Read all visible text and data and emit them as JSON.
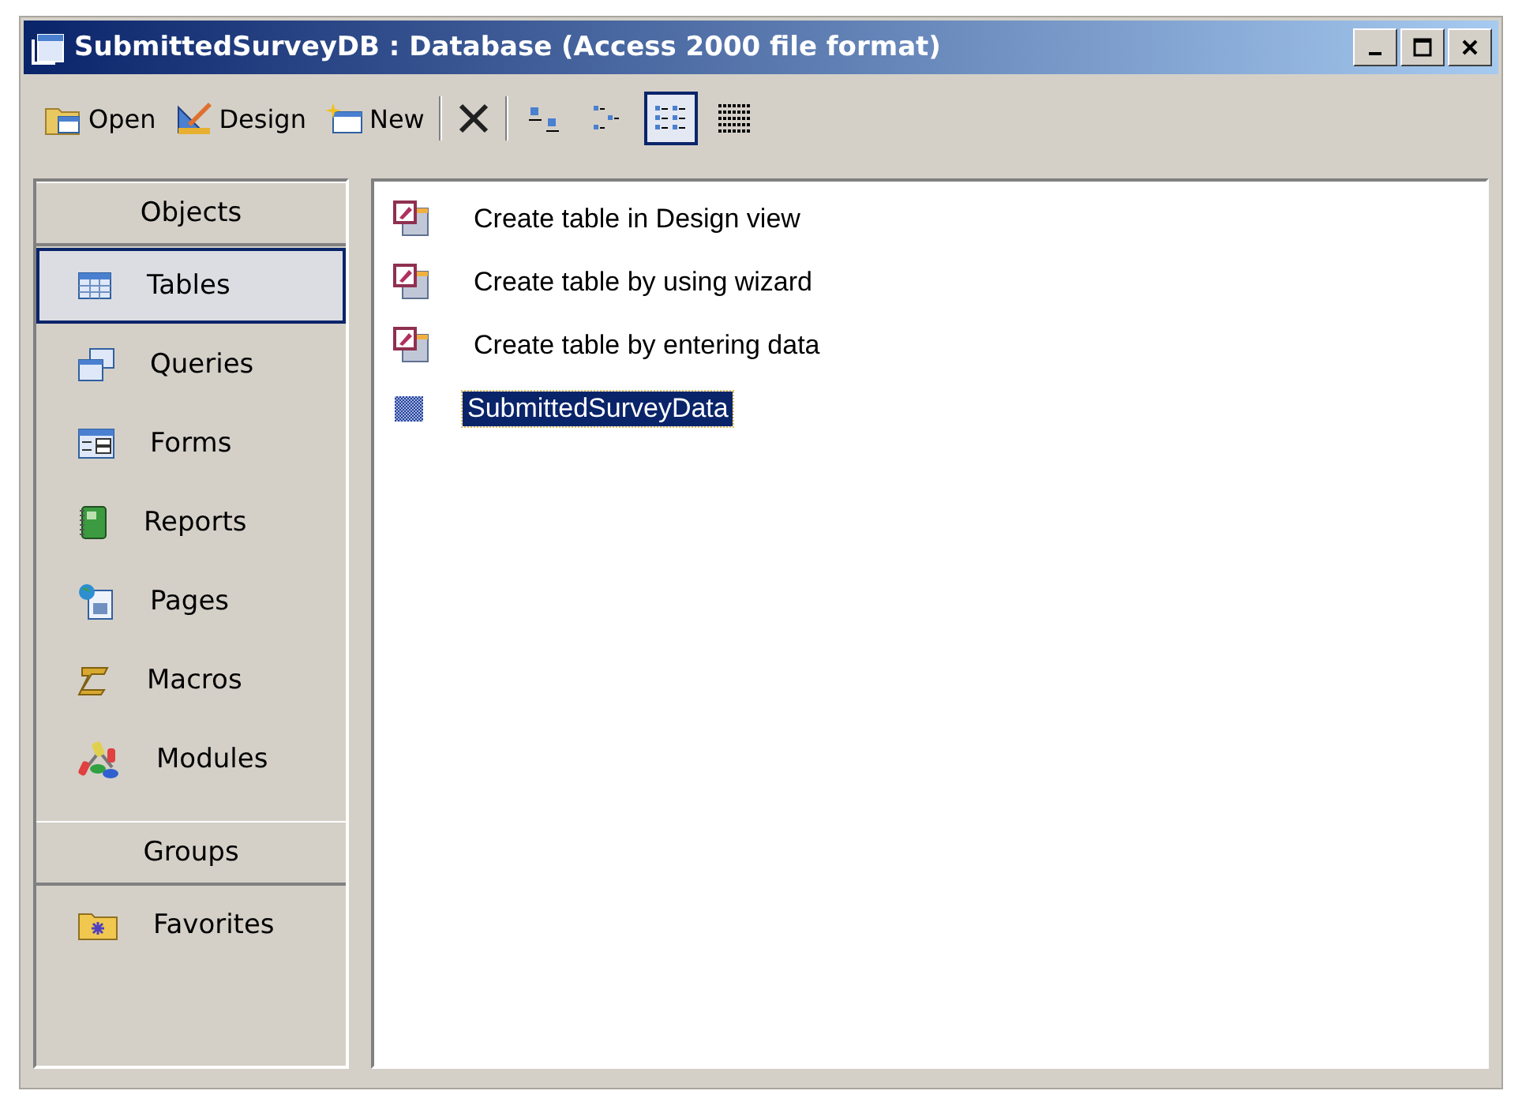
{
  "window": {
    "title": "SubmittedSurveyDB : Database (Access 2000 file format)"
  },
  "toolbar": {
    "actions": [
      {
        "kind": "open",
        "label": "Open"
      },
      {
        "kind": "design",
        "label": "Design"
      },
      {
        "kind": "new",
        "label": "New"
      },
      {
        "kind": "delete"
      }
    ],
    "views": [
      {
        "kind": "large",
        "selected": false
      },
      {
        "kind": "small",
        "selected": false
      },
      {
        "kind": "list",
        "selected": true
      },
      {
        "kind": "details",
        "selected": false
      }
    ]
  },
  "sidebar": {
    "sections": [
      {
        "title": "Objects",
        "items": [
          {
            "kind": "tables",
            "label": "Tables",
            "selected": true
          },
          {
            "kind": "queries",
            "label": "Queries",
            "selected": false
          },
          {
            "kind": "forms",
            "label": "Forms",
            "selected": false
          },
          {
            "kind": "reports",
            "label": "Reports",
            "selected": false
          },
          {
            "kind": "pages",
            "label": "Pages",
            "selected": false
          },
          {
            "kind": "macros",
            "label": "Macros",
            "selected": false
          },
          {
            "kind": "modules",
            "label": "Modules",
            "selected": false
          }
        ]
      },
      {
        "title": "Groups",
        "items": [
          {
            "kind": "favorites",
            "label": "Favorites",
            "selected": false
          }
        ]
      }
    ]
  },
  "list": {
    "items": [
      {
        "kind": "shortcut",
        "label": "Create table in Design view",
        "selected": false
      },
      {
        "kind": "shortcut",
        "label": "Create table by using wizard",
        "selected": false
      },
      {
        "kind": "shortcut",
        "label": "Create table by entering data",
        "selected": false
      },
      {
        "kind": "table",
        "label": "SubmittedSurveyData",
        "selected": true
      }
    ]
  }
}
